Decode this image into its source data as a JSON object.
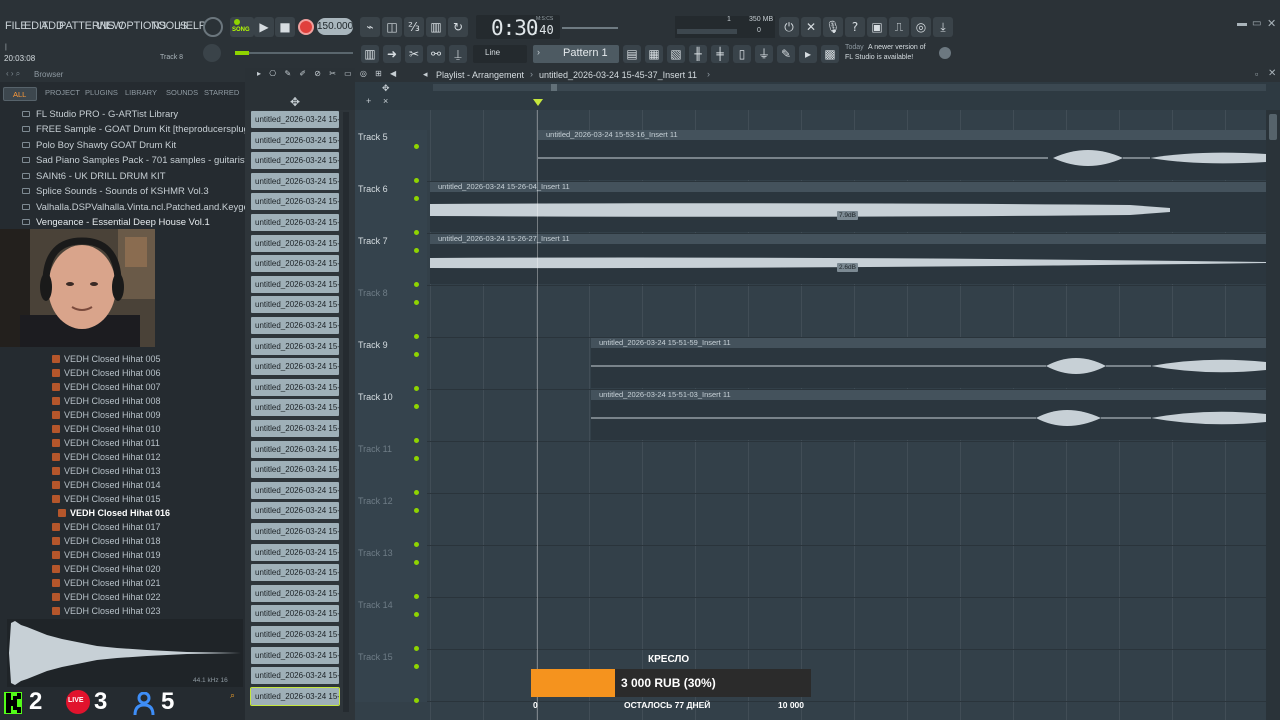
{
  "menu": [
    "FILE",
    "EDIT",
    "ADD",
    "PATTERNS",
    "VIEW",
    "OPTIONS",
    "TOOLS",
    "HELP"
  ],
  "transport": {
    "mode_label": "SONG",
    "tempo": "150.000",
    "time_main": "0:30",
    "time_sub": ":40",
    "time_unit": "M:S:CS",
    "cpu_label": "1",
    "mem_label": "350 MB",
    "voices": "0"
  },
  "hint": {
    "left_line1": "|",
    "left_line2": "20:03:08",
    "track_label": "Track 8"
  },
  "snap_mode": "Line",
  "pattern_selector": "Pattern 1",
  "news": {
    "when": "Today",
    "line1": "A newer version of",
    "line2": "FL Studio is available!"
  },
  "browser": {
    "title": "Browser",
    "tabs": [
      "ALL",
      "PROJECT",
      "PLUGINS",
      "LIBRARY",
      "SOUNDS",
      "STARRED"
    ],
    "libraries": [
      "FL Studio PRO - G-ARTist Library",
      "FREE Sample - GOAT Drum Kit [theproducersplug.com]",
      "Polo Boy Shawty GOAT Drum Kit",
      "Sad Piano Samples Pack - 701 samples - guitarist1.ru",
      "SAINt6 - UK DRILL DRUM KIT",
      "Splice Sounds - Sounds of KSHMR Vol.3",
      "Valhalla.DSPValhalla.Vinta.ncl.Patched.and.Keygen-R2R",
      "Vengeance - Essential Deep House Vol.1"
    ],
    "samples": [
      "VEDH Closed Hihat 005",
      "VEDH Closed Hihat 006",
      "VEDH Closed Hihat 007",
      "VEDH Closed Hihat 008",
      "VEDH Closed Hihat 009",
      "VEDH Closed Hihat 010",
      "VEDH Closed Hihat 011",
      "VEDH Closed Hihat 012",
      "VEDH Closed Hihat 013",
      "VEDH Closed Hihat 014",
      "VEDH Closed Hihat 015",
      "VEDH Closed Hihat 016",
      "VEDH Closed Hihat 017",
      "VEDH Closed Hihat 018",
      "VEDH Closed Hihat 019",
      "VEDH Closed Hihat 020",
      "VEDH Closed Hihat 021",
      "VEDH Closed Hihat 022",
      "VEDH Closed Hihat 023"
    ],
    "selected_sample": "VEDH Closed Hihat 016",
    "preview_info": "44.1 kHz 16"
  },
  "channels": {
    "label": "untitled_2026-03-24 15-...",
    "count": 29
  },
  "playlist": {
    "title": "Playlist - Arrangement",
    "breadcrumb": "untitled_2026-03-24 15-45-37_Insert 11",
    "tracks": [
      {
        "name": "Track 5",
        "active": true,
        "clip": "untitled_2026-03-24 15-53-16_Insert 11",
        "db": ""
      },
      {
        "name": "Track 6",
        "active": true,
        "clip": "untitled_2026-03-24 15-26-04_Insert 11",
        "db": "7.9dB"
      },
      {
        "name": "Track 7",
        "active": true,
        "clip": "untitled_2026-03-24 15-26-27_Insert 11",
        "db": "2.6dB"
      },
      {
        "name": "Track 8",
        "active": false,
        "clip": "",
        "db": ""
      },
      {
        "name": "Track 9",
        "active": true,
        "clip": "untitled_2026-03-24 15-51-59_Insert 11",
        "db": ""
      },
      {
        "name": "Track 10",
        "active": true,
        "clip": "untitled_2026-03-24 15-51-03_Insert 11",
        "db": ""
      },
      {
        "name": "Track 11",
        "active": false,
        "clip": "",
        "db": ""
      },
      {
        "name": "Track 12",
        "active": false,
        "clip": "",
        "db": ""
      },
      {
        "name": "Track 13",
        "active": false,
        "clip": "",
        "db": ""
      },
      {
        "name": "Track 14",
        "active": false,
        "clip": "",
        "db": ""
      },
      {
        "name": "Track 15",
        "active": false,
        "clip": "",
        "db": ""
      }
    ]
  },
  "donation_goal": {
    "title": "КРЕСЛО",
    "amount": "3 000 RUB (30%)",
    "progress": 0.3,
    "start": "0",
    "remaining": "ОСТАЛОСЬ 77 ДНЕЙ",
    "end": "10 000"
  },
  "stream_stats": {
    "kick": "2",
    "live_badge": "LIVE",
    "live": "3",
    "viewers": "5"
  },
  "colors": {
    "topbar": "#2b3237",
    "browser_bg": "#252b30",
    "playlist_bg": "#334049",
    "record": "#e0403c",
    "kick_green": "#53fc18",
    "live_red": "#e1132d",
    "viewer_blue": "#3e8ef7",
    "goal_orange": "#f5931e"
  }
}
